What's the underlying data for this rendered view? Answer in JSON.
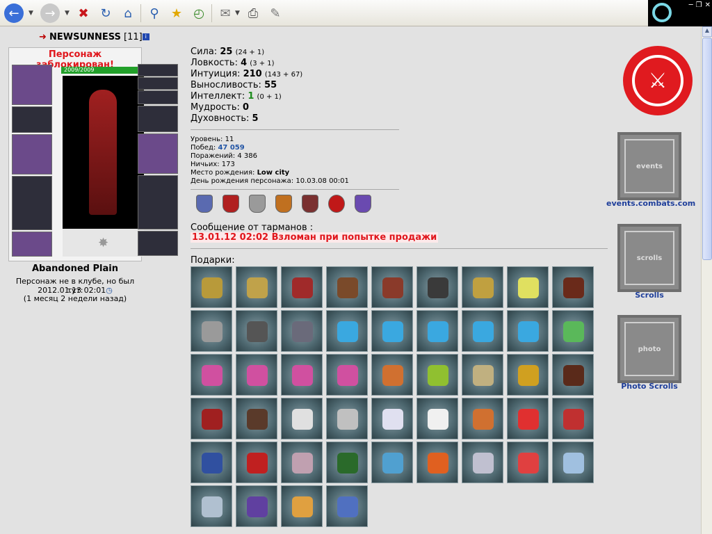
{
  "character": {
    "name": "NEWSUNNESS",
    "level_tag": "[11]",
    "blocked": "Персонаж заблокирован!",
    "hp": "2009/2009",
    "location": "Abandoned Plain",
    "club_line": "Персонаж не в клубе, но был тут:",
    "last_seen": "2012.01.13 02:01",
    "ago": "(1 месяц 2 недели назад)"
  },
  "stats": [
    {
      "label": "Сила:",
      "value": "25",
      "extra": "(24 + 1)"
    },
    {
      "label": "Ловкость:",
      "value": "4",
      "extra": "(3 + 1)"
    },
    {
      "label": "Интуиция:",
      "value": "210",
      "extra": "(143 + 67)"
    },
    {
      "label": "Выносливость:",
      "value": "55",
      "extra": ""
    },
    {
      "label": "Интеллект:",
      "value": "1",
      "extra": "(0 + 1)"
    },
    {
      "label": "Мудрость:",
      "value": "0",
      "extra": ""
    },
    {
      "label": "Духовность:",
      "value": "5",
      "extra": ""
    }
  ],
  "info": {
    "level": "Уровень: 11",
    "wins_label": "Побед:",
    "wins": "47 059",
    "losses": "Поражений: 4 386",
    "draws": "Ничьих: 173",
    "birthplace_label": "Место рождения:",
    "birthplace": "Low city",
    "birthday": "День рождения персонажа: 10.03.08 00:01"
  },
  "message": {
    "label": "Сообщение от тарманов :",
    "text": "13.01.12 02:02 Взломан при попытке продажи"
  },
  "gifts_label": "Подарки:",
  "banners": {
    "events": "events.combats.com",
    "scrolls": "Scrolls",
    "photo": "Photo Scrolls",
    "events_inner": "events",
    "scrolls_inner": "scrolls",
    "photo_inner": "photo"
  },
  "colors": {
    "accent_red": "#e01a1f",
    "link_blue": "#1e3e9a"
  }
}
